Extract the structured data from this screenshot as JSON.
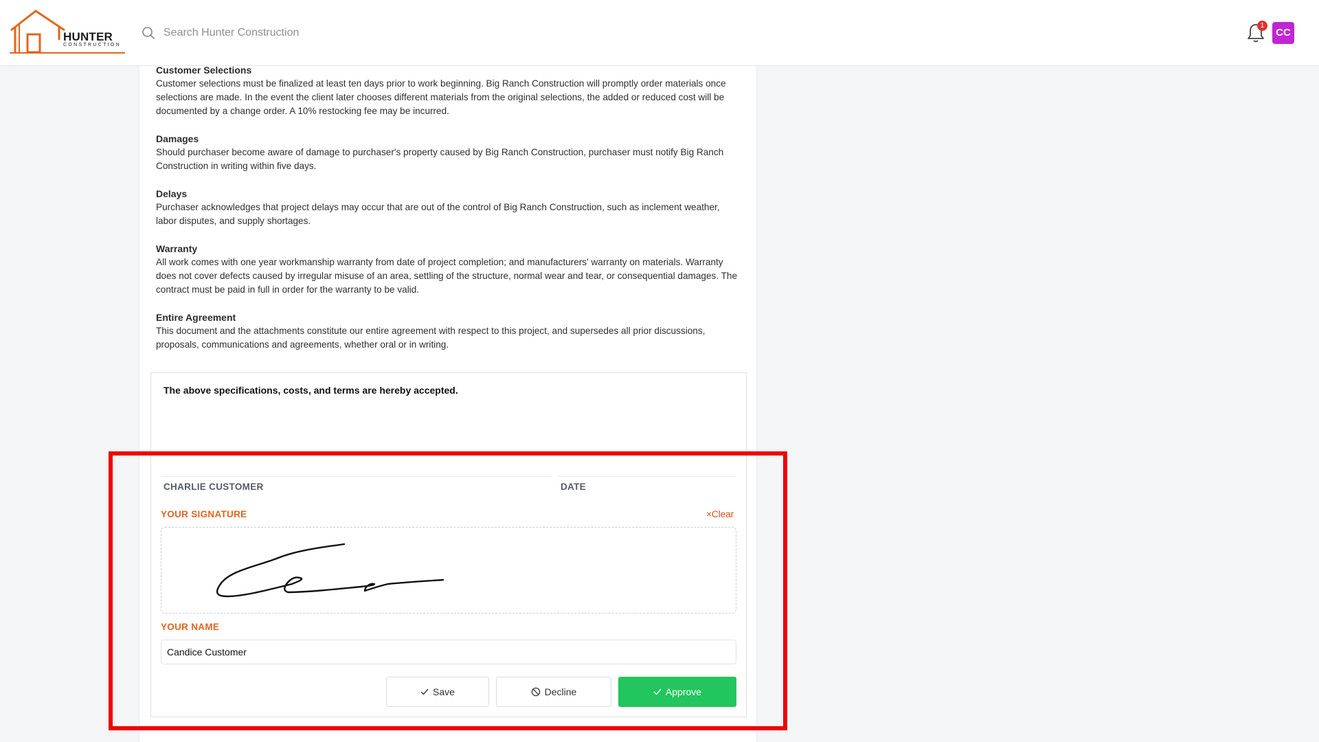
{
  "header": {
    "brand": "HUNTER",
    "brand_sub": "CONSTRUCTION",
    "search_placeholder": "Search Hunter Construction",
    "notification_count": "1",
    "avatar_initials": "CC"
  },
  "document": {
    "sections": [
      {
        "title": "Customer Selections",
        "body": "Customer selections must be finalized at least ten days prior to work beginning. Big Ranch Construction will promptly order materials once selections are made. In the event the client later chooses different materials from the original selections, the added or reduced cost will be documented by a change order. A 10% restocking fee may be incurred."
      },
      {
        "title": "Damages",
        "body": "Should purchaser become aware of damage to purchaser's property caused by Big Ranch Construction, purchaser must notify Big Ranch Construction in writing within five days."
      },
      {
        "title": "Delays",
        "body": "Purchaser acknowledges that project delays may occur that are out of the control of Big Ranch Construction, such as inclement weather, labor disputes, and supply shortages."
      },
      {
        "title": "Warranty",
        "body": "All work comes with one year workmanship warranty from date of project completion; and manufacturers' warranty on materials. Warranty does not cover defects caused by irregular misuse of an area, settling of the structure, normal wear and tear, or consequential damages. The contract must be paid in full in order for the warranty to be valid."
      },
      {
        "title": "Entire Agreement",
        "body": "This document and the attachments constitute our entire agreement with respect to this project, and supersedes all prior discussions, proposals, communications and agreements, whether oral or in writing."
      }
    ]
  },
  "acceptance": {
    "statement": "The above specifications, costs, and terms are hereby accepted.",
    "signer_name": "CHARLIE CUSTOMER",
    "date_label": "DATE",
    "signature_label": "YOUR SIGNATURE",
    "clear_label": "Clear",
    "name_label": "YOUR NAME",
    "name_value": "Candice Customer",
    "save_label": "Save",
    "decline_label": "Decline",
    "approve_label": "Approve",
    "approve_color": "#22c55e",
    "label_color": "#e0661e"
  }
}
